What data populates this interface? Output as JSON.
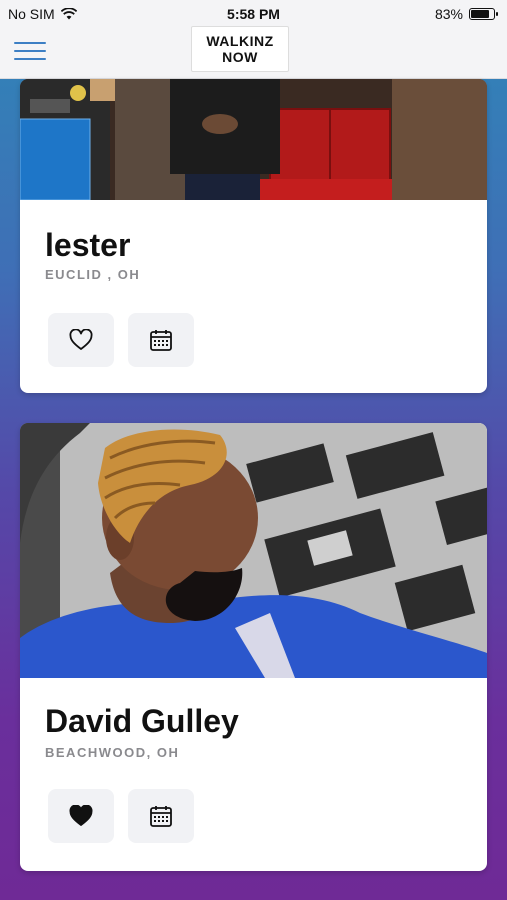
{
  "status_bar": {
    "carrier": "No SIM",
    "time": "5:58 PM",
    "battery": "83%",
    "battery_level": 0.83
  },
  "header": {
    "logo_line1": "WALKINZ",
    "logo_line2": "NOW",
    "menu_icon": "hamburger-menu-icon"
  },
  "barbers": [
    {
      "name": "lester",
      "location": "EUCLID , OH",
      "favorite": false
    },
    {
      "name": "David Gulley",
      "location": "BEACHWOOD, OH",
      "favorite": true
    }
  ],
  "colors": {
    "accent": "#3d7fc4",
    "card_bg": "#ffffff",
    "button_bg": "#f1f2f5",
    "location_text": "#8a8a8e"
  }
}
